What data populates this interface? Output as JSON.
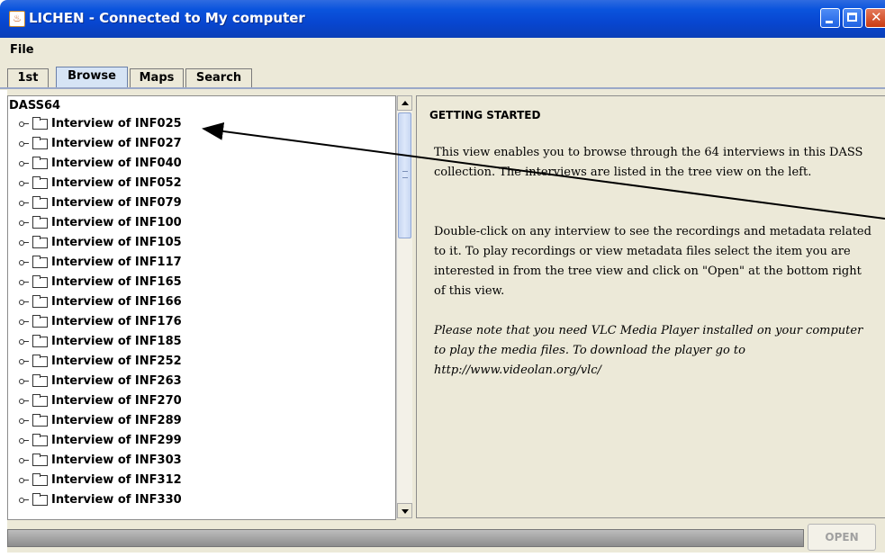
{
  "window": {
    "title": "LICHEN - Connected to My computer"
  },
  "menu": {
    "file": "File"
  },
  "tabs": [
    {
      "label": "1st"
    },
    {
      "label": "Browse",
      "active": true
    },
    {
      "label": "Maps"
    },
    {
      "label": "Search"
    }
  ],
  "tree": {
    "root": "DASS64",
    "items": [
      "Interview of INF025",
      "Interview of INF027",
      "Interview of INF040",
      "Interview of INF052",
      "Interview of INF079",
      "Interview of INF100",
      "Interview of INF105",
      "Interview of INF117",
      "Interview of INF165",
      "Interview of INF166",
      "Interview of INF176",
      "Interview of INF185",
      "Interview of INF252",
      "Interview of INF263",
      "Interview of INF270",
      "Interview of INF289",
      "Interview of INF299",
      "Interview of INF303",
      "Interview of INF312",
      "Interview of INF330"
    ]
  },
  "info": {
    "heading": "GETTING STARTED",
    "p1": "This view enables you to browse through the 64 interviews in this DASS collection. The interviews are listed in the tree view on the left.",
    "p2": "Double-click on any interview to see the recordings and metadata related to it. To play recordings or view metadata files select the item you are interested in from the tree view and click on \"Open\" at the bottom right of this view.",
    "p3": "Please note that you need VLC Media Player installed on your computer to play the media files. To download the player go to http://www.videolan.org/vlc/"
  },
  "buttons": {
    "open": "OPEN"
  },
  "colors": {
    "titlebar": "#0a54dd",
    "window_bg": "#ece9d8",
    "active_tab": "#d6e4f5"
  }
}
